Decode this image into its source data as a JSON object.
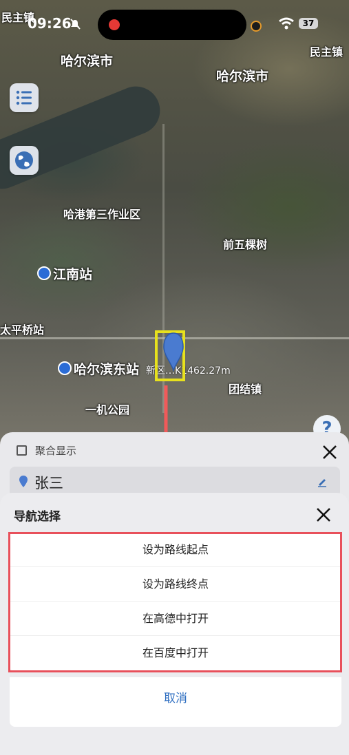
{
  "status_bar": {
    "time": "09:26",
    "battery": "37"
  },
  "map": {
    "labels": [
      {
        "id": "minzhu-left",
        "text": "民主镇"
      },
      {
        "id": "harbin-left",
        "text": "哈尔滨市"
      },
      {
        "id": "harbin-right",
        "text": "哈尔滨市"
      },
      {
        "id": "minzhu-right",
        "text": "民主镇"
      },
      {
        "id": "hagang",
        "text": "哈港第三作业区"
      },
      {
        "id": "qianwu",
        "text": "前五棵树"
      },
      {
        "id": "jiangnan",
        "text": "江南站"
      },
      {
        "id": "taiping",
        "text": "太平桥站"
      },
      {
        "id": "harbin-east",
        "text": "哈尔滨东站"
      },
      {
        "id": "tuanjie",
        "text": "团结镇"
      },
      {
        "id": "yiji",
        "text": "一机公园"
      }
    ],
    "marker_label": "新区…K1462.27m",
    "help_label": "?"
  },
  "back_sheet": {
    "aggregate_label": "聚合显示",
    "contact_name": "张三"
  },
  "nav_sheet": {
    "title": "导航选择",
    "options": [
      {
        "label": "设为路线起点"
      },
      {
        "label": "设为路线终点"
      },
      {
        "label": "在高德中打开"
      },
      {
        "label": "在百度中打开"
      }
    ],
    "cancel_label": "取消"
  },
  "colors": {
    "accent_blue": "#2f6fc1",
    "annotation_red": "#e8505b",
    "annotation_yellow": "#e7e11d",
    "marker_blue": "#4a7bd0"
  }
}
